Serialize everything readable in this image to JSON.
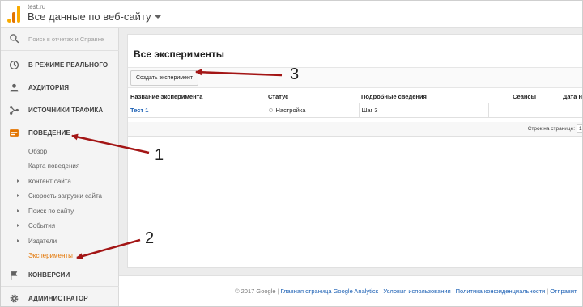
{
  "header": {
    "site_url": "test.ru",
    "property_name": "Все данные по веб-сайту"
  },
  "sidebar": {
    "search_placeholder": "Поиск в отчетах и Справке",
    "items": [
      {
        "label": "В РЕЖИМЕ РЕАЛЬНОГО",
        "icon": "clock-icon"
      },
      {
        "label": "АУДИТОРИЯ",
        "icon": "person-icon"
      },
      {
        "label": "ИСТОЧНИКИ ТРАФИКА",
        "icon": "acquisition-icon"
      },
      {
        "label": "ПОВЕДЕНИЕ",
        "icon": "behavior-icon"
      },
      {
        "label": "КОНВЕРСИИ",
        "icon": "flag-icon"
      },
      {
        "label": "АДМИНИСТРАТОР",
        "icon": "gear-icon"
      }
    ],
    "behavior_sub": [
      {
        "label": "Обзор",
        "expandable": false
      },
      {
        "label": "Карта поведения",
        "expandable": false
      },
      {
        "label": "Контент сайта",
        "expandable": true
      },
      {
        "label": "Скорость загрузки сайта",
        "expandable": true
      },
      {
        "label": "Поиск по сайту",
        "expandable": true
      },
      {
        "label": "События",
        "expandable": true
      },
      {
        "label": "Издатели",
        "expandable": true
      },
      {
        "label": "Эксперименты",
        "expandable": false,
        "active": true
      }
    ]
  },
  "main": {
    "title": "Все эксперименты",
    "create_button": "Создать эксперимент",
    "table": {
      "columns": [
        "Название эксперимента",
        "Статус",
        "Подробные сведения",
        "Сеансы",
        "Дата н"
      ],
      "rows": [
        {
          "name": "Тест 1",
          "status": "Настройка",
          "details": "Шаг 3",
          "sessions": "–",
          "date": "–"
        }
      ]
    },
    "rows_per_page_label": "Строк на странице:",
    "rows_per_page_value": "1"
  },
  "footer": {
    "copyright": "© 2017 Google",
    "links": [
      "Главная страница Google Analytics",
      "Условия использования",
      "Политика конфиденциальности",
      "Отправит"
    ]
  },
  "annotations": {
    "labels": [
      "1",
      "2",
      "3"
    ],
    "arrow_color": "#a31515"
  },
  "colors": {
    "accent_orange": "#e37400",
    "link_blue": "#1a5fb4",
    "sidebar_bg": "#f4f4f4",
    "main_bg": "#ececec"
  }
}
